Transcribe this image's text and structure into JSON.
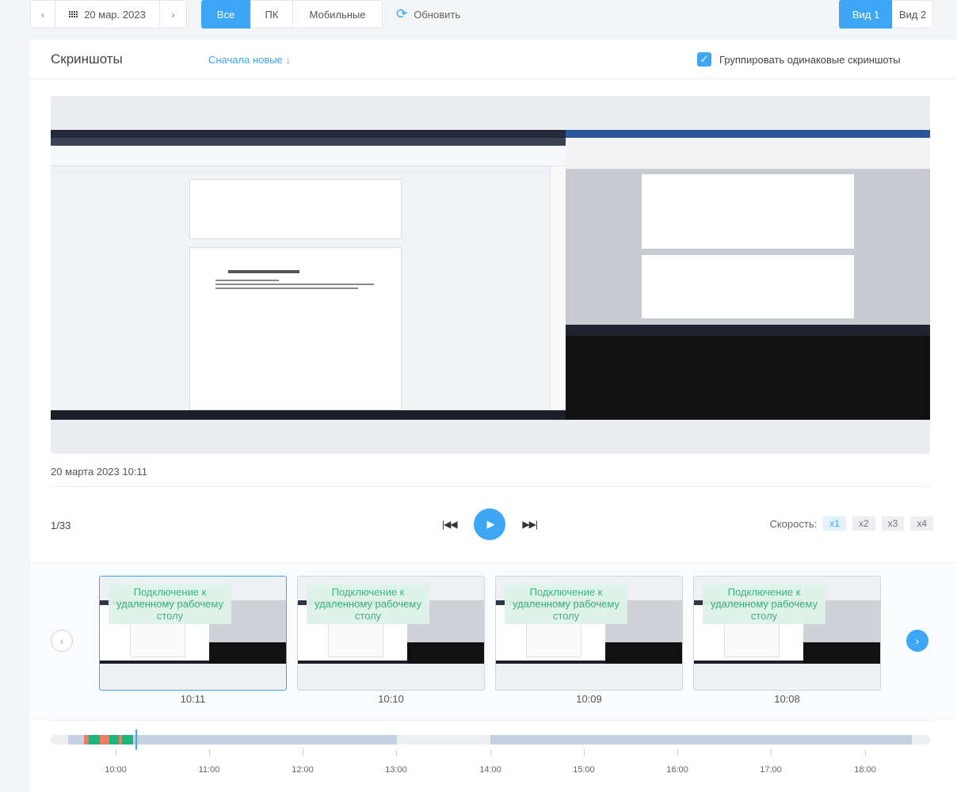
{
  "toolbar": {
    "prev_label": "‹",
    "date_label": "20 мар. 2023",
    "next_label": "›",
    "filters": [
      "Все",
      "ПК",
      "Мобильные"
    ],
    "refresh_label": "Обновить",
    "views": [
      "Вид 1",
      "Вид 2"
    ]
  },
  "header": {
    "title": "Скриншоты",
    "sort_label": "Сначала новые  ↓",
    "group_label": "Группировать одинаковые скриншоты",
    "group_checked": true
  },
  "preview": {
    "datetime": "20 марта 2023 10:11"
  },
  "player": {
    "counter": "1/33",
    "speed_label": "Скорость:",
    "speeds": [
      "x1",
      "x2",
      "x3",
      "x4"
    ],
    "active_speed": "x1"
  },
  "thumbnails": [
    {
      "label": "Подключение к удаленному рабочему столу",
      "time": "10:11",
      "active": true
    },
    {
      "label": "Подключение к удаленному рабочему столу",
      "time": "10:10",
      "active": false
    },
    {
      "label": "Подключение к удаленному рабочему столу",
      "time": "10:09",
      "active": false
    },
    {
      "label": "Подключение к удаленному рабочему столу",
      "time": "10:08",
      "active": false
    }
  ],
  "timeline": {
    "ticks": [
      "10:00",
      "11:00",
      "12:00",
      "13:00",
      "14:00",
      "15:00",
      "16:00",
      "17:00",
      "18:00"
    ],
    "colors": {
      "activity_green": "#1db57a",
      "activity_red": "#f07a62",
      "cursor": "#3da6f5",
      "range": "#c5d0e0"
    }
  },
  "colors": {
    "accent": "#3da6f5",
    "label_green": "#32b37a"
  }
}
